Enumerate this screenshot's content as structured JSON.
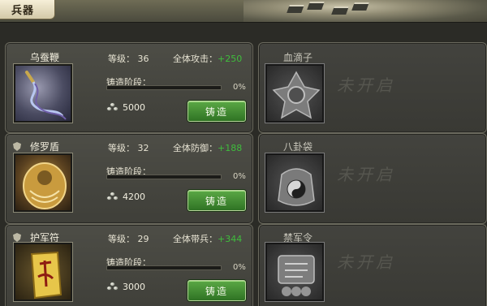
{
  "tab": {
    "label": "兵器"
  },
  "labels": {
    "level": "等级：",
    "forge_stage": "铸造阶段：",
    "forge_button": "铸造",
    "locked": "未开启"
  },
  "weapons": [
    {
      "name": "乌蚕鞭",
      "level": "36",
      "bonus_label": "全体攻击：",
      "bonus_value": "+250",
      "progress_text": "0%",
      "progress": 0,
      "cost": "5000",
      "icon": "whip-icon"
    },
    {
      "name": "修罗盾",
      "level": "32",
      "bonus_label": "全体防御：",
      "bonus_value": "+188",
      "progress_text": "0%",
      "progress": 0,
      "cost": "4200",
      "icon": "shield-weapon-icon"
    },
    {
      "name": "护军符",
      "level": "29",
      "bonus_label": "全体带兵：",
      "bonus_value": "+344",
      "progress_text": "0%",
      "progress": 0,
      "cost": "3000",
      "icon": "talisman-icon"
    }
  ],
  "locked_weapons": [
    {
      "name": "血滴子",
      "icon": "blood-drop-icon"
    },
    {
      "name": "八卦袋",
      "icon": "bagua-bag-icon"
    },
    {
      "name": "禁军令",
      "icon": "token-icon"
    }
  ],
  "colors": {
    "bonus": "#3fbd3c",
    "button": "#4a9338",
    "panel": "#45453f"
  }
}
